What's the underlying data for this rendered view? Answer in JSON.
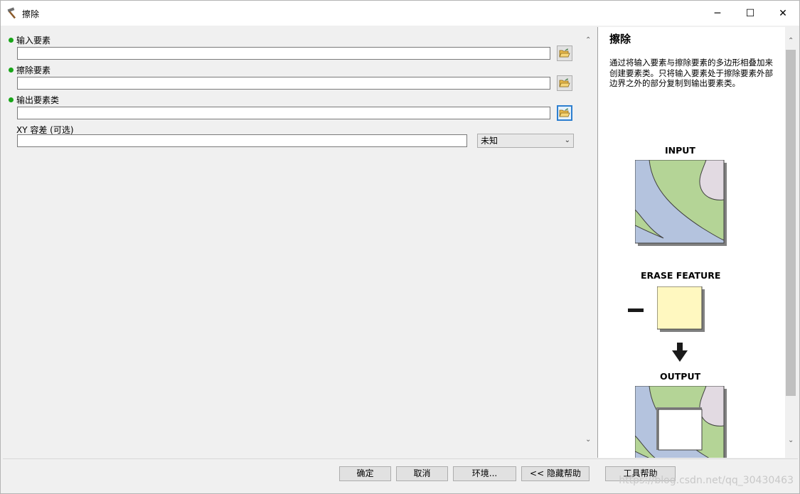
{
  "window": {
    "title": "擦除",
    "minimize_glyph": "─",
    "maximize_glyph": "☐",
    "close_glyph": "✕"
  },
  "params": {
    "input_label": "输入要素",
    "erase_label": "擦除要素",
    "output_label": "输出要素类",
    "xy_label": "XY 容差 (可选)",
    "unit_value": "未知",
    "input_value": "",
    "erase_value": "",
    "output_value": "",
    "xy_value": ""
  },
  "help": {
    "title": "擦除",
    "description": "通过将输入要素与擦除要素的多边形相叠加来创建要素类。只将输入要素处于擦除要素外部边界之外的部分复制到输出要素类。",
    "diagram_input_label": "INPUT",
    "diagram_erase_label": "ERASE FEATURE",
    "diagram_output_label": "OUTPUT"
  },
  "buttons": {
    "ok": "确定",
    "cancel": "取消",
    "environments": "环境...",
    "hide_help": "<< 隐藏帮助",
    "tool_help": "工具帮助"
  },
  "watermark": "https://blog.csdn.net/qq_30430463",
  "colors": {
    "required_dot": "#19a619",
    "map_green": "#b4d496",
    "map_blue": "#b4c3de",
    "map_pink": "#e2dae2",
    "erase_yellow": "#fff8c0"
  },
  "icons": {
    "app": "hammer-icon",
    "browse": "open-folder-icon",
    "scroll_up": "chevron-up-icon",
    "scroll_down": "chevron-down-icon",
    "dropdown": "chevron-down-icon"
  }
}
